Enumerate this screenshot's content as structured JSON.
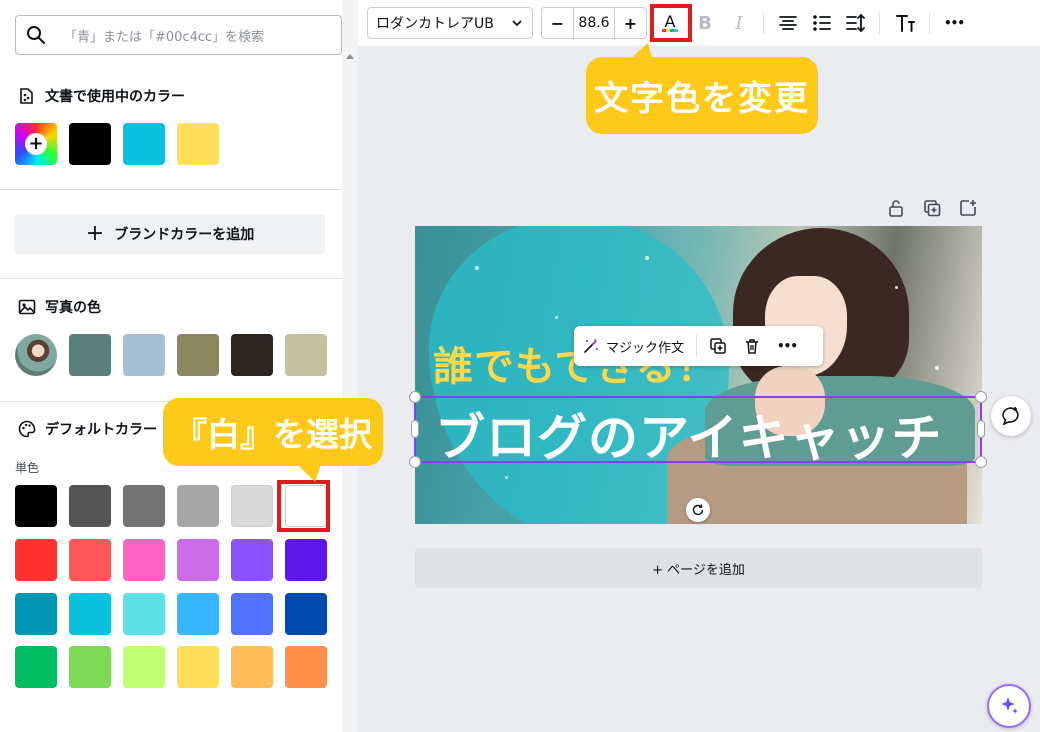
{
  "search": {
    "placeholder": "「青」または「#00c4cc」を検索"
  },
  "doc_colors": {
    "title": "文書で使用中のカラー",
    "swatches": [
      "#000000",
      "#0cc0df",
      "#ffde59"
    ]
  },
  "brand": {
    "add_label": "ブランドカラーを追加"
  },
  "photo_colors": {
    "title": "写真の色",
    "swatches": [
      "#5b7f7a",
      "#a7c1d4",
      "#8b8560",
      "#2c2520",
      "#c4c1a1"
    ]
  },
  "default_colors": {
    "title": "デフォルトカラー",
    "solid_label": "単色",
    "rows": [
      [
        "#000000",
        "#545454",
        "#737373",
        "#a6a6a6",
        "#d9d9d9",
        "#ffffff"
      ],
      [
        "#ff3131",
        "#ff5757",
        "#ff66c4",
        "#cb6ce6",
        "#8c52ff",
        "#5e17eb"
      ],
      [
        "#0097b2",
        "#0cc0df",
        "#5ce1e6",
        "#38b6ff",
        "#5271ff",
        "#004aad"
      ],
      [
        "#00bf63",
        "#7ed957",
        "#c1ff72",
        "#ffde59",
        "#ffbd59",
        "#ff914d"
      ]
    ]
  },
  "toolbar": {
    "font_name": "ロダンカトレアUB",
    "font_size": "88.6",
    "minus": "−",
    "plus": "+",
    "text_color_glyph": "A",
    "bold_glyph": "B",
    "italic_glyph": "I",
    "more_glyph": "•••"
  },
  "annotations": {
    "text_color_callout": "文字色を変更",
    "white_callout": "『白』を選択"
  },
  "design": {
    "line1": "誰でもできる！",
    "line2": "ブログのアイキャッチ"
  },
  "context_menu": {
    "magic_label": "マジック作文",
    "more_glyph": "•••"
  },
  "canvas": {
    "add_page_label": "+ ページを追加"
  },
  "colors": {
    "accent": "#8b3dff",
    "highlight": "#e01b1b",
    "callout": "#ffc91a"
  }
}
